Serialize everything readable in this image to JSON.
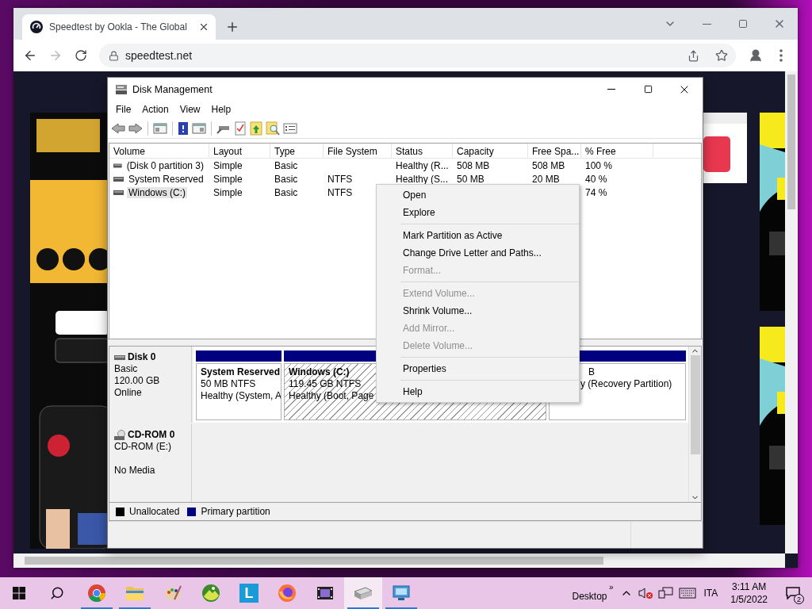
{
  "browser": {
    "tab_title": "Speedtest by Ookla - The Global",
    "url": "speedtest.net",
    "forward_disabled": true
  },
  "disk_management": {
    "title": "Disk Management",
    "menu": [
      "File",
      "Action",
      "View",
      "Help"
    ],
    "columns": [
      "Volume",
      "Layout",
      "Type",
      "File System",
      "Status",
      "Capacity",
      "Free Spa...",
      "% Free"
    ],
    "rows": [
      {
        "selected": false,
        "cells": [
          "(Disk 0 partition 3)",
          "Simple",
          "Basic",
          null,
          "Healthy (R...",
          "508 MB",
          "508 MB",
          "100 %"
        ]
      },
      {
        "selected": false,
        "cells": [
          "System Reserved",
          "Simple",
          "Basic",
          "NTFS",
          "Healthy (S...",
          "50 MB",
          "20 MB",
          "40 %"
        ]
      },
      {
        "selected": true,
        "cells": [
          "Windows (C:)",
          "Simple",
          "Basic",
          "NTFS",
          null,
          null,
          null,
          "74 %"
        ]
      }
    ],
    "disks": [
      {
        "kind": "disk",
        "name": "Disk 0",
        "type": "Basic",
        "size": "120.00 GB",
        "status": "Online",
        "partitions": [
          {
            "name": "System Reserved",
            "lines": [
              "50 MB NTFS",
              "Healthy (System, A"
            ],
            "selected": false
          },
          {
            "name": "Windows (C:)",
            "lines": [
              "119.45 GB NTFS",
              "Healthy (Boot, Page"
            ],
            "selected": true
          },
          {
            "lines": [
              "B",
              "y (Recovery Partition)"
            ],
            "selected": false
          }
        ]
      },
      {
        "kind": "cdrom",
        "name": "CD-ROM 0",
        "type": "CD-ROM (E:)",
        "status": "No Media"
      }
    ],
    "legend": [
      {
        "label": "Unallocated",
        "color": "#000000"
      },
      {
        "label": "Primary partition",
        "color": "#000080"
      }
    ]
  },
  "context_menu": {
    "groups": [
      {
        "items": [
          {
            "label": "Open",
            "disabled": false
          },
          {
            "label": "Explore",
            "disabled": false
          }
        ]
      },
      {
        "items": [
          {
            "label": "Mark Partition as Active",
            "disabled": false
          },
          {
            "label": "Change Drive Letter and Paths...",
            "disabled": false
          },
          {
            "label": "Format...",
            "disabled": true
          }
        ]
      },
      {
        "items": [
          {
            "label": "Extend Volume...",
            "disabled": true
          },
          {
            "label": "Shrink Volume...",
            "disabled": false
          },
          {
            "label": "Add Mirror...",
            "disabled": true
          },
          {
            "label": "Delete Volume...",
            "disabled": true
          }
        ]
      },
      {
        "items": [
          {
            "label": "Properties",
            "disabled": false
          }
        ]
      },
      {
        "items": [
          {
            "label": "Help",
            "disabled": false
          }
        ]
      }
    ]
  },
  "taskbar": {
    "apps": [
      {
        "kind": "chrome",
        "running": true,
        "selected": false
      },
      {
        "kind": "folder",
        "running": true,
        "selected": false
      },
      {
        "kind": "palette",
        "running": false,
        "selected": false
      },
      {
        "kind": "landscape",
        "running": false,
        "selected": false
      },
      {
        "kind": "letter",
        "label": "L",
        "running": false,
        "selected": false
      },
      {
        "kind": "firefox",
        "running": false,
        "selected": false
      },
      {
        "kind": "film",
        "running": false,
        "selected": false
      },
      {
        "kind": "drive",
        "running": true,
        "selected": true
      },
      {
        "kind": "monitor",
        "running": true,
        "selected": false
      }
    ],
    "toolbar_label": "Desktop",
    "toolbar_chevron": "»",
    "language": "ITA",
    "time": "3:11 AM",
    "date": "1/5/2022",
    "notifications": "2"
  }
}
